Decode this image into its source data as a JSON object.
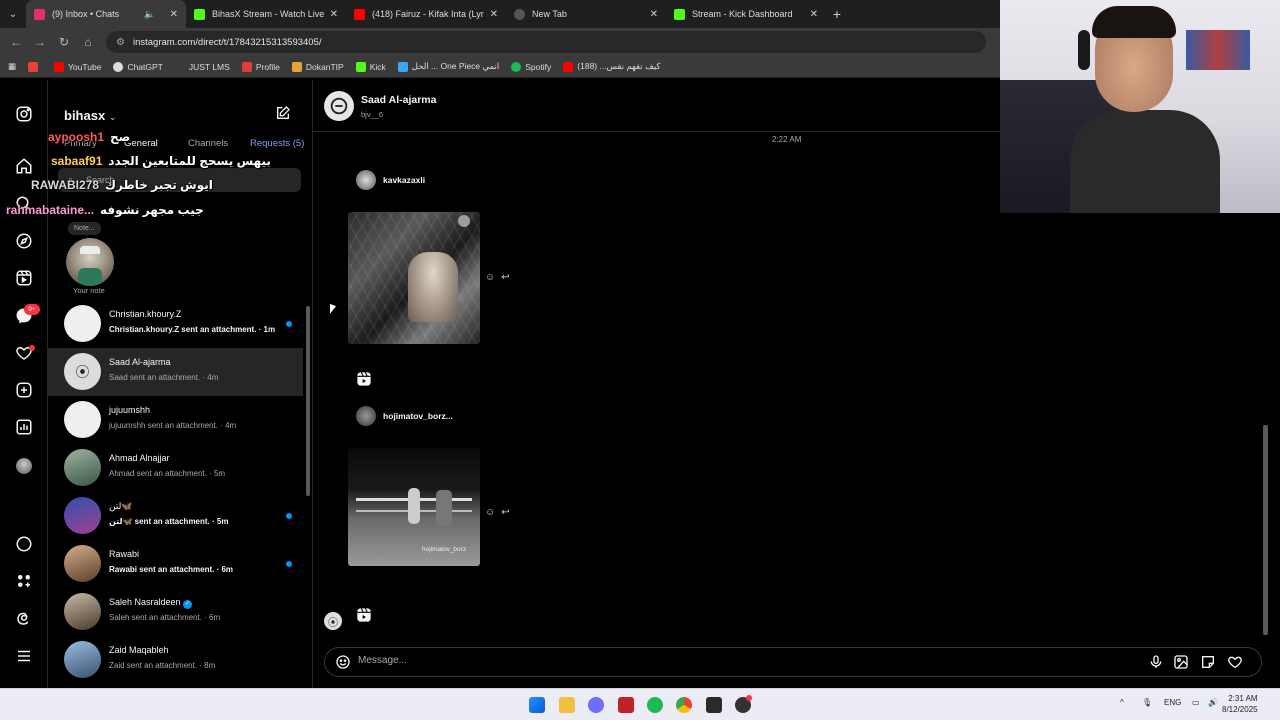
{
  "browser": {
    "tabs": [
      {
        "title": "(9) Inbox • Chats",
        "color": "#e1306c",
        "active": true
      },
      {
        "title": "BihasX Stream - Watch Live on",
        "color": "#53fc18"
      },
      {
        "title": "(418) Fairuz - Kifak Inta (Lyric Vi",
        "color": "#ff0000"
      },
      {
        "title": "New Tab",
        "color": "#cccccc"
      },
      {
        "title": "Stream - Kick Dashboard",
        "color": "#53fc18"
      }
    ],
    "url": "instagram.com/direct/t/17843215313593405/",
    "bookmarks": [
      {
        "label": "",
        "color": "#ea4335"
      },
      {
        "label": "YouTube",
        "color": "#ff0000"
      },
      {
        "label": "ChatGPT",
        "color": "#dddddd"
      },
      {
        "label": "JUST LMS",
        "color": "#3a3a3a"
      },
      {
        "label": "Profile",
        "color": "#e33b3b"
      },
      {
        "label": "DokanTIP",
        "color": "#e8a23a"
      },
      {
        "label": "Kick",
        "color": "#53fc18"
      },
      {
        "label": "الحل ... One Piece انمي",
        "color": "#39a7ff"
      },
      {
        "label": "Spotify",
        "color": "#1db954"
      },
      {
        "label": "كيف تفهم نفس... (188)",
        "color": "#ff0000"
      }
    ]
  },
  "inbox": {
    "username": "bihasx",
    "tabs": {
      "primary": "Primary",
      "general": "General",
      "channels": "Channels",
      "requests": "Requests (5)"
    },
    "search_placeholder": "Search",
    "note_bubble": "Note...",
    "note_label": "Your note",
    "notif_badge": "9+",
    "threads": [
      {
        "name": "Christian.khoury.Z",
        "preview": "Christian.khoury.Z sent an attachment. · 1m",
        "unread": true,
        "color": "#efefef"
      },
      {
        "name": "Saad Al-ajarma",
        "preview": "Saad sent an attachment. · 4m",
        "unread": false,
        "selected": true,
        "color": "#dcdcdc"
      },
      {
        "name": "jujuumshh",
        "preview": "jujuumshh sent an attachment. · 4m",
        "unread": false,
        "color": "#efefef"
      },
      {
        "name": "Ahmad Alnajjar",
        "preview": "Ahmad sent an attachment. · 5m",
        "unread": false,
        "color": "#4d6a55"
      },
      {
        "name": "لتن🦋",
        "preview": "لتن🦋 sent an attachment. · 5m",
        "unread": true,
        "color": "#6a3d7a"
      },
      {
        "name": "Rawabi",
        "preview": "Rawabi sent an attachment. · 6m",
        "unread": true,
        "color": "#8a6a4a"
      },
      {
        "name": "Saleh Nasraldeen",
        "preview": "Saleh sent an attachment. · 6m",
        "unread": false,
        "verified": true,
        "color": "#7a6a5a"
      },
      {
        "name": "Zaid Maqableh",
        "preview": "Zaid sent an attachment. · 8m",
        "unread": false,
        "color": "#5a7a9a"
      }
    ]
  },
  "stream_overlay": [
    {
      "user": "aypoosh1",
      "msg": "صح"
    },
    {
      "user": "sabaaf91",
      "msg": "بيهس يسحج للمتابعين الجدد"
    },
    {
      "user": "RAWABI278",
      "msg": "ايوش تجبر خاطرك"
    },
    {
      "user": "rahmabataine...",
      "msg": "جيب مجهر نشوفه"
    }
  ],
  "chat": {
    "name": "Saad Al-ajarma",
    "handle": "bjv__6",
    "timestamp": "2:22 AM",
    "shares": [
      {
        "author": "kavkazaxli",
        "caption": ""
      },
      {
        "author": "hojimatov_borz...",
        "caption": "hojimatov_borz"
      }
    ],
    "message_placeholder": "Message..."
  },
  "taskbar": {
    "lang": "ENG",
    "time": "2:31 AM",
    "date": "8/12/2025"
  }
}
